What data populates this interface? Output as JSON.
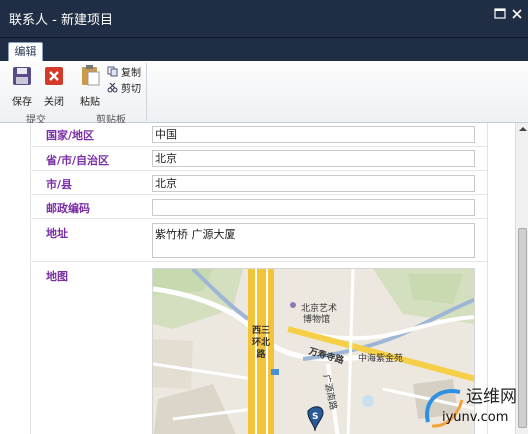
{
  "window": {
    "title": "联系人 - 新建项目"
  },
  "ribbon": {
    "tab_edit": "编辑",
    "save": "保存",
    "close": "关闭",
    "paste": "粘贴",
    "copy": "复制",
    "cut": "剪切",
    "group_commit": "提交",
    "group_clipboard": "剪贴板"
  },
  "form": {
    "country_label": "国家/地区",
    "country_value": "中国",
    "province_label": "省/市/自治区",
    "province_value": "北京",
    "city_label": "市/县",
    "city_value": "北京",
    "postcode_label": "邮政编码",
    "postcode_value": "",
    "address_label": "地址",
    "address_value": "紫竹桥 广源大厦",
    "map_label": "地图"
  },
  "map": {
    "museum": "北京艺术",
    "museum2": "博物馆",
    "road1": "万寿寺路",
    "road_ring": "西三环北路",
    "community": "中海紫金苑",
    "road2": "广源南路",
    "marker_letter": "S"
  },
  "watermark": {
    "brand": "运维网",
    "site": "iyunv.com"
  }
}
